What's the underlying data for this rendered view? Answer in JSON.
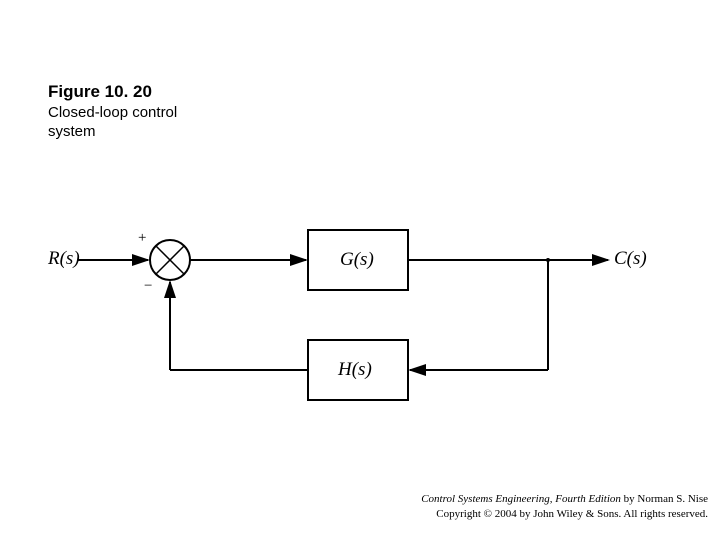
{
  "figure": {
    "number": "Figure 10. 20",
    "caption": "Closed-loop control\nsystem"
  },
  "labels": {
    "input": "R(s)",
    "output": "C(s)",
    "forward_block": "G(s)",
    "feedback_block": "H(s)",
    "plus": "+",
    "minus": "−"
  },
  "footer": {
    "book": "Control Systems Engineering, Fourth Edition",
    "author": " by Norman S. Nise",
    "copyright": "Copyright © 2004 by John Wiley & Sons. All rights reserved."
  }
}
